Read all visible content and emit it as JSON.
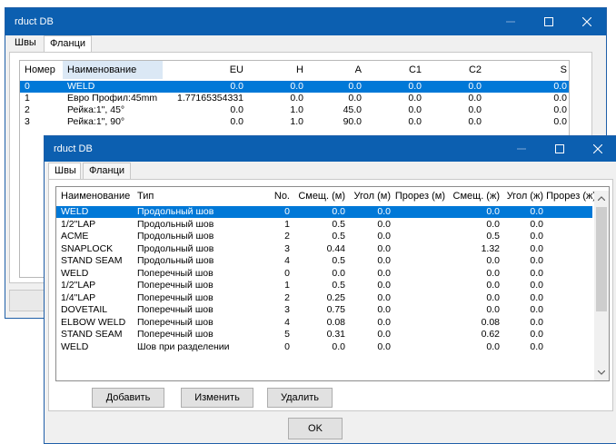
{
  "back_window": {
    "title": "rduct DB",
    "tabs": [
      "Швы",
      "Фланци"
    ],
    "columns": [
      "Номер",
      "Наименование",
      "EU",
      "H",
      "A",
      "C1",
      "C2",
      "S"
    ],
    "rows": [
      [
        "0",
        "WELD",
        "0.0",
        "0.0",
        "0.0",
        "0.0",
        "0.0",
        "0.0"
      ],
      [
        "1",
        "Евро Профил:45mm",
        "1.77165354331",
        "0.0",
        "0.0",
        "0.0",
        "0.0",
        "0.0"
      ],
      [
        "2",
        "Рейка:1\", 45°",
        "0.0",
        "1.0",
        "45.0",
        "0.0",
        "0.0",
        "0.0"
      ],
      [
        "3",
        "Рейка:1\", 90°",
        "0.0",
        "1.0",
        "90.0",
        "0.0",
        "0.0",
        "0.0"
      ]
    ]
  },
  "front_window": {
    "title": "rduct DB",
    "tabs": [
      "Швы",
      "Фланци"
    ],
    "columns": [
      "Наименование",
      "Тип",
      "No.",
      "Смещ. (м)",
      "Угол (м)",
      "Прорез (м)",
      "Смещ. (ж)",
      "Угол (ж)",
      "Прорез (ж)"
    ],
    "rows": [
      [
        "WELD",
        "Продольный шов",
        "0",
        "0.0",
        "0.0",
        "",
        "0.0",
        "0.0",
        ""
      ],
      [
        "1/2\"LAP",
        "Продольный шов",
        "1",
        "0.5",
        "0.0",
        "",
        "0.0",
        "0.0",
        ""
      ],
      [
        "ACME",
        "Продольный шов",
        "2",
        "0.5",
        "0.0",
        "",
        "0.5",
        "0.0",
        ""
      ],
      [
        "SNAPLOCK",
        "Продольный шов",
        "3",
        "0.44",
        "0.0",
        "",
        "1.32",
        "0.0",
        ""
      ],
      [
        "STAND SEAM",
        "Продольный шов",
        "4",
        "0.5",
        "0.0",
        "",
        "0.0",
        "0.0",
        ""
      ],
      [
        "WELD",
        "Поперечный шов",
        "0",
        "0.0",
        "0.0",
        "",
        "0.0",
        "0.0",
        ""
      ],
      [
        "1/2\"LAP",
        "Поперечный шов",
        "1",
        "0.5",
        "0.0",
        "",
        "0.0",
        "0.0",
        ""
      ],
      [
        "1/4\"LAP",
        "Поперечный шов",
        "2",
        "0.25",
        "0.0",
        "",
        "0.0",
        "0.0",
        ""
      ],
      [
        "DOVETAIL",
        "Поперечный шов",
        "3",
        "0.75",
        "0.0",
        "",
        "0.0",
        "0.0",
        ""
      ],
      [
        "ELBOW WELD",
        "Поперечный шов",
        "4",
        "0.08",
        "0.0",
        "",
        "0.08",
        "0.0",
        ""
      ],
      [
        "STAND SEAM",
        "Поперечный шов",
        "5",
        "0.31",
        "0.0",
        "",
        "0.62",
        "0.0",
        ""
      ],
      [
        "WELD",
        "Шов при разделении",
        "0",
        "0.0",
        "0.0",
        "",
        "0.0",
        "0.0",
        ""
      ]
    ],
    "buttons": {
      "add": "Добавить",
      "edit": "Изменить",
      "delete": "Удалить",
      "ok": "OK"
    }
  },
  "icons": {
    "minimize": "minimize-icon",
    "maximize": "maximize-icon",
    "close": "close-icon"
  },
  "colors": {
    "titlebar": "#0c5fb0",
    "selection": "#0078d7"
  }
}
